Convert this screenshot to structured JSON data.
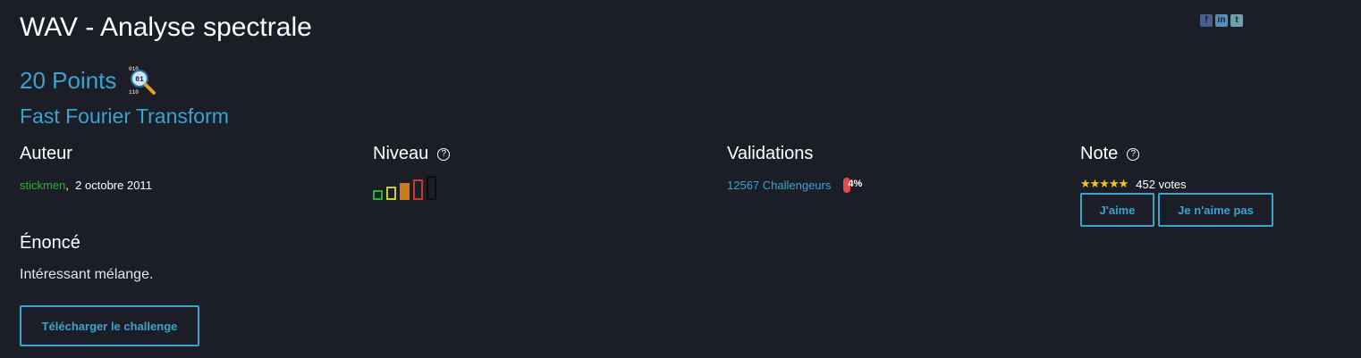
{
  "challenge": {
    "title": "WAV - Analyse spectrale",
    "points": "20 Points",
    "category_icon": "magnifier-binary-icon",
    "category_icon_text": "01",
    "subtitle": "Fast Fourier Transform"
  },
  "share": {
    "icons": [
      "facebook-icon",
      "linkedin-icon",
      "twitter-icon"
    ]
  },
  "author_section": {
    "heading": "Auteur",
    "author": "stickmen",
    "separator": ",",
    "date": "2 octobre 2011"
  },
  "level_section": {
    "heading": "Niveau",
    "help": "?",
    "level": 3,
    "max_level": 5,
    "colors": [
      "#22b52e",
      "#cccc33",
      "#cc7a1a",
      "#c43a2a",
      "#111111"
    ]
  },
  "validations_section": {
    "heading": "Validations",
    "challengers": "12567 Challengeurs",
    "percent_label": "4%",
    "percent": 4
  },
  "note_section": {
    "heading": "Note",
    "help": "?",
    "stars": "★★★★★",
    "votes": "452 votes",
    "like_label": "J'aime",
    "dislike_label": "Je n'aime pas"
  },
  "statement": {
    "heading": "Énoncé",
    "text": "Intéressant mélange.",
    "download_label": "Télécharger le challenge"
  },
  "colors": {
    "background": "#1b1e27",
    "accent": "#3aa3d0",
    "author": "#22b52e",
    "percent_bar": "#e14b52",
    "star": "#f5c518"
  }
}
